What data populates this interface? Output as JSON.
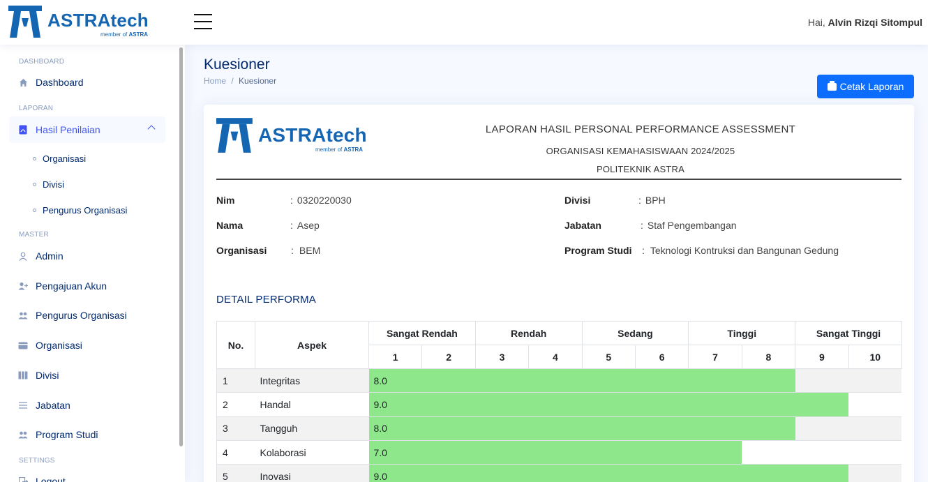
{
  "header": {
    "logo_text": "ASTRAtech",
    "logo_sub_prefix": "member of",
    "logo_sub_brand": "ASTRA",
    "greeting_prefix": "Hai,",
    "user_name": "Alvin Rizqi Sitompul"
  },
  "sidebar": {
    "sections": {
      "dashboard": "DASHBOARD",
      "laporan": "LAPORAN",
      "master": "MASTER",
      "settings": "SETTINGS"
    },
    "dashboard": "Dashboard",
    "hasil_penilaian": "Hasil Penilaian",
    "sub": [
      "Organisasi",
      "Divisi",
      "Pengurus Organisasi"
    ],
    "master": [
      "Admin",
      "Pengajuan Akun",
      "Pengurus Organisasi",
      "Organisasi",
      "Divisi",
      "Jabatan",
      "Program Studi"
    ],
    "logout": "Logout"
  },
  "main": {
    "title": "Kuesioner",
    "breadcrumb_home": "Home",
    "breadcrumb_sep": "/",
    "breadcrumb_current": "Kuesioner",
    "print_button": "Cetak Laporan"
  },
  "report": {
    "title": "LAPORAN HASIL PERSONAL PERFORMANCE ASSESSMENT",
    "org": "ORGANISASI KEMAHASISWAAN 2024/2025",
    "school": "POLITEKNIK ASTRA",
    "sep": ":",
    "nim_label": "Nim",
    "nim": "0320220030",
    "nama_label": "Nama",
    "nama": "Asep",
    "organisasi_label": "Organisasi",
    "organisasi": "BEM",
    "divisi_label": "Divisi",
    "divisi": "BPH",
    "jabatan_label": "Jabatan",
    "jabatan": "Staf Pengembangan",
    "prodi_label": "Program Studi",
    "prodi": "Teknologi Kontruksi dan Bangunan Gedung",
    "detail_title": "DETAIL PERFORMA"
  },
  "table": {
    "col_no": "No.",
    "col_aspek": "Aspek",
    "groups": [
      "Sangat Rendah",
      "Rendah",
      "Sedang",
      "Tinggi",
      "Sangat Tinggi"
    ],
    "scale": [
      "1",
      "2",
      "3",
      "4",
      "5",
      "6",
      "7",
      "8",
      "9",
      "10"
    ],
    "rows": [
      {
        "no": "1",
        "aspek": "Integritas",
        "score": "8.0",
        "value": 8
      },
      {
        "no": "2",
        "aspek": "Handal",
        "score": "9.0",
        "value": 9
      },
      {
        "no": "3",
        "aspek": "Tangguh",
        "score": "8.0",
        "value": 8
      },
      {
        "no": "4",
        "aspek": "Kolaborasi",
        "score": "7.0",
        "value": 7
      },
      {
        "no": "5",
        "aspek": "Inovasi",
        "score": "9.0",
        "value": 9
      }
    ],
    "bar_color": "#8ee78a"
  }
}
